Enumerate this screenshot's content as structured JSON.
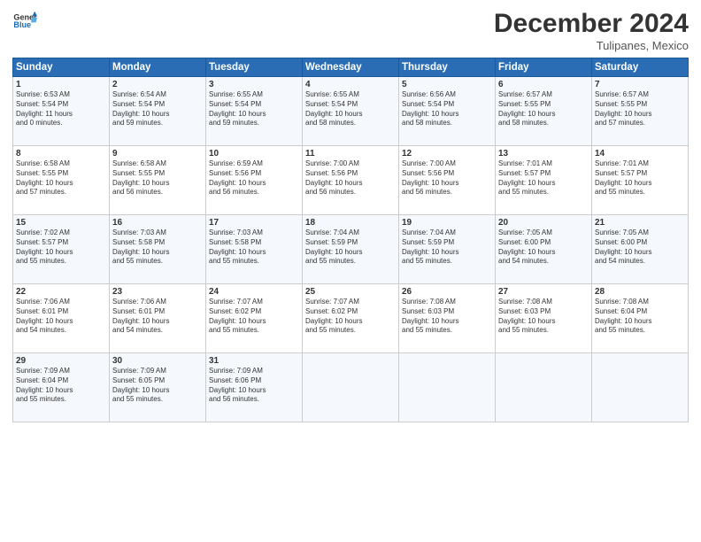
{
  "logo": {
    "line1": "General",
    "line2": "Blue"
  },
  "title": "December 2024",
  "subtitle": "Tulipanes, Mexico",
  "days_of_week": [
    "Sunday",
    "Monday",
    "Tuesday",
    "Wednesday",
    "Thursday",
    "Friday",
    "Saturday"
  ],
  "weeks": [
    [
      {
        "day": "1",
        "info": "Sunrise: 6:53 AM\nSunset: 5:54 PM\nDaylight: 11 hours\nand 0 minutes."
      },
      {
        "day": "2",
        "info": "Sunrise: 6:54 AM\nSunset: 5:54 PM\nDaylight: 10 hours\nand 59 minutes."
      },
      {
        "day": "3",
        "info": "Sunrise: 6:55 AM\nSunset: 5:54 PM\nDaylight: 10 hours\nand 59 minutes."
      },
      {
        "day": "4",
        "info": "Sunrise: 6:55 AM\nSunset: 5:54 PM\nDaylight: 10 hours\nand 58 minutes."
      },
      {
        "day": "5",
        "info": "Sunrise: 6:56 AM\nSunset: 5:54 PM\nDaylight: 10 hours\nand 58 minutes."
      },
      {
        "day": "6",
        "info": "Sunrise: 6:57 AM\nSunset: 5:55 PM\nDaylight: 10 hours\nand 58 minutes."
      },
      {
        "day": "7",
        "info": "Sunrise: 6:57 AM\nSunset: 5:55 PM\nDaylight: 10 hours\nand 57 minutes."
      }
    ],
    [
      {
        "day": "8",
        "info": "Sunrise: 6:58 AM\nSunset: 5:55 PM\nDaylight: 10 hours\nand 57 minutes."
      },
      {
        "day": "9",
        "info": "Sunrise: 6:58 AM\nSunset: 5:55 PM\nDaylight: 10 hours\nand 56 minutes."
      },
      {
        "day": "10",
        "info": "Sunrise: 6:59 AM\nSunset: 5:56 PM\nDaylight: 10 hours\nand 56 minutes."
      },
      {
        "day": "11",
        "info": "Sunrise: 7:00 AM\nSunset: 5:56 PM\nDaylight: 10 hours\nand 56 minutes."
      },
      {
        "day": "12",
        "info": "Sunrise: 7:00 AM\nSunset: 5:56 PM\nDaylight: 10 hours\nand 56 minutes."
      },
      {
        "day": "13",
        "info": "Sunrise: 7:01 AM\nSunset: 5:57 PM\nDaylight: 10 hours\nand 55 minutes."
      },
      {
        "day": "14",
        "info": "Sunrise: 7:01 AM\nSunset: 5:57 PM\nDaylight: 10 hours\nand 55 minutes."
      }
    ],
    [
      {
        "day": "15",
        "info": "Sunrise: 7:02 AM\nSunset: 5:57 PM\nDaylight: 10 hours\nand 55 minutes."
      },
      {
        "day": "16",
        "info": "Sunrise: 7:03 AM\nSunset: 5:58 PM\nDaylight: 10 hours\nand 55 minutes."
      },
      {
        "day": "17",
        "info": "Sunrise: 7:03 AM\nSunset: 5:58 PM\nDaylight: 10 hours\nand 55 minutes."
      },
      {
        "day": "18",
        "info": "Sunrise: 7:04 AM\nSunset: 5:59 PM\nDaylight: 10 hours\nand 55 minutes."
      },
      {
        "day": "19",
        "info": "Sunrise: 7:04 AM\nSunset: 5:59 PM\nDaylight: 10 hours\nand 55 minutes."
      },
      {
        "day": "20",
        "info": "Sunrise: 7:05 AM\nSunset: 6:00 PM\nDaylight: 10 hours\nand 54 minutes."
      },
      {
        "day": "21",
        "info": "Sunrise: 7:05 AM\nSunset: 6:00 PM\nDaylight: 10 hours\nand 54 minutes."
      }
    ],
    [
      {
        "day": "22",
        "info": "Sunrise: 7:06 AM\nSunset: 6:01 PM\nDaylight: 10 hours\nand 54 minutes."
      },
      {
        "day": "23",
        "info": "Sunrise: 7:06 AM\nSunset: 6:01 PM\nDaylight: 10 hours\nand 54 minutes."
      },
      {
        "day": "24",
        "info": "Sunrise: 7:07 AM\nSunset: 6:02 PM\nDaylight: 10 hours\nand 55 minutes."
      },
      {
        "day": "25",
        "info": "Sunrise: 7:07 AM\nSunset: 6:02 PM\nDaylight: 10 hours\nand 55 minutes."
      },
      {
        "day": "26",
        "info": "Sunrise: 7:08 AM\nSunset: 6:03 PM\nDaylight: 10 hours\nand 55 minutes."
      },
      {
        "day": "27",
        "info": "Sunrise: 7:08 AM\nSunset: 6:03 PM\nDaylight: 10 hours\nand 55 minutes."
      },
      {
        "day": "28",
        "info": "Sunrise: 7:08 AM\nSunset: 6:04 PM\nDaylight: 10 hours\nand 55 minutes."
      }
    ],
    [
      {
        "day": "29",
        "info": "Sunrise: 7:09 AM\nSunset: 6:04 PM\nDaylight: 10 hours\nand 55 minutes."
      },
      {
        "day": "30",
        "info": "Sunrise: 7:09 AM\nSunset: 6:05 PM\nDaylight: 10 hours\nand 55 minutes."
      },
      {
        "day": "31",
        "info": "Sunrise: 7:09 AM\nSunset: 6:06 PM\nDaylight: 10 hours\nand 56 minutes."
      },
      {
        "day": "",
        "info": ""
      },
      {
        "day": "",
        "info": ""
      },
      {
        "day": "",
        "info": ""
      },
      {
        "day": "",
        "info": ""
      }
    ]
  ]
}
